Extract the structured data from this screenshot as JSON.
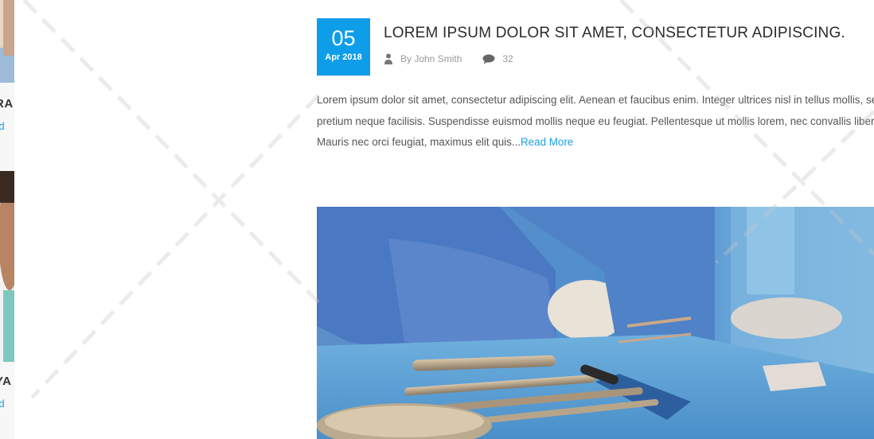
{
  "left_sidebar": {
    "cards": [
      {
        "name_fragment": "RA",
        "role_fragment": "rd"
      },
      {
        "name_fragment": "YA",
        "role_fragment": "rd"
      }
    ]
  },
  "post": {
    "date": {
      "day": "05",
      "month_year": "Apr 2018"
    },
    "title": "LOREM IPSUM DOLOR SIT AMET, CONSECTETUR ADIPISCING.",
    "author": "By John Smith",
    "comments": "32",
    "excerpt": "Lorem ipsum dolor sit amet, consectetur adipiscing elit. Aenean et faucibus enim. Integer ultrices nisl in tellus mollis, sed pretium neque facilisis. Suspendisse euismod mollis neque eu feugiat. Pellentesque ut mollis lorem, nec convallis libero. Mauris nec orci feugiat, maximus elit quis...",
    "read_more": "Read More"
  },
  "colors": {
    "accent": "#0e9de8",
    "link": "#1a9fe0",
    "title": "#2b2b2b",
    "body_text": "#555555",
    "meta_text": "#9a9a9a"
  },
  "icons": {
    "author": "user-icon",
    "comments": "comment-icon"
  }
}
